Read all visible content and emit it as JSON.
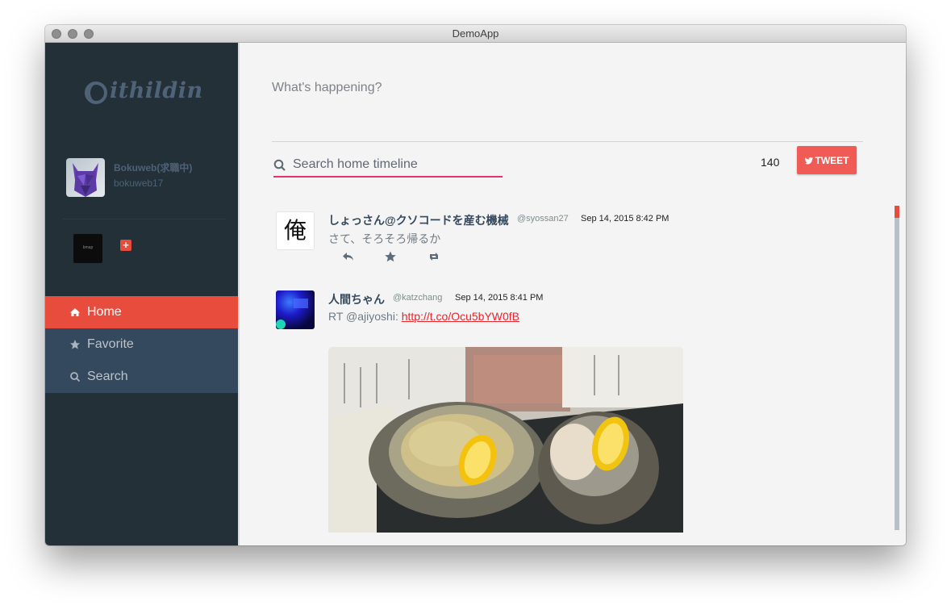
{
  "window": {
    "title": "DemoApp"
  },
  "sidebar": {
    "logo_text": "ithildin",
    "user": {
      "name": "Bokuweb(求職中)",
      "handle": "bokuweb17"
    },
    "account_thumb_label": "bmap",
    "add_account_label": "+",
    "nav": [
      {
        "label": "Home",
        "icon": "home-icon",
        "active": true
      },
      {
        "label": "Favorite",
        "icon": "star-icon",
        "active": false
      },
      {
        "label": "Search",
        "icon": "search-icon",
        "active": false
      }
    ]
  },
  "compose": {
    "placeholder": "What's happening?",
    "char_count": "140",
    "tweet_button": "TWEET"
  },
  "search": {
    "placeholder": "Search home timeline"
  },
  "timeline": [
    {
      "name": "しょっさん@クソコードを産む機械",
      "handle": "@syossan27",
      "time": "Sep 14, 2015 8:42 PM",
      "avatar_glyph": "俺",
      "text": "さて、そろそろ帰るか"
    },
    {
      "name": "人間ちゃん",
      "handle": "@katzchang",
      "time": "Sep 14, 2015 8:41 PM",
      "text_prefix": "RT @ajiyoshi: ",
      "link": "http://t.co/Ocu5bYW0fB"
    }
  ],
  "colors": {
    "sidebar_bg": "#233038",
    "nav_bg": "#34495e",
    "accent": "#e84c3d",
    "search_underline": "#e1356f",
    "tweet_button": "#f05b55"
  }
}
